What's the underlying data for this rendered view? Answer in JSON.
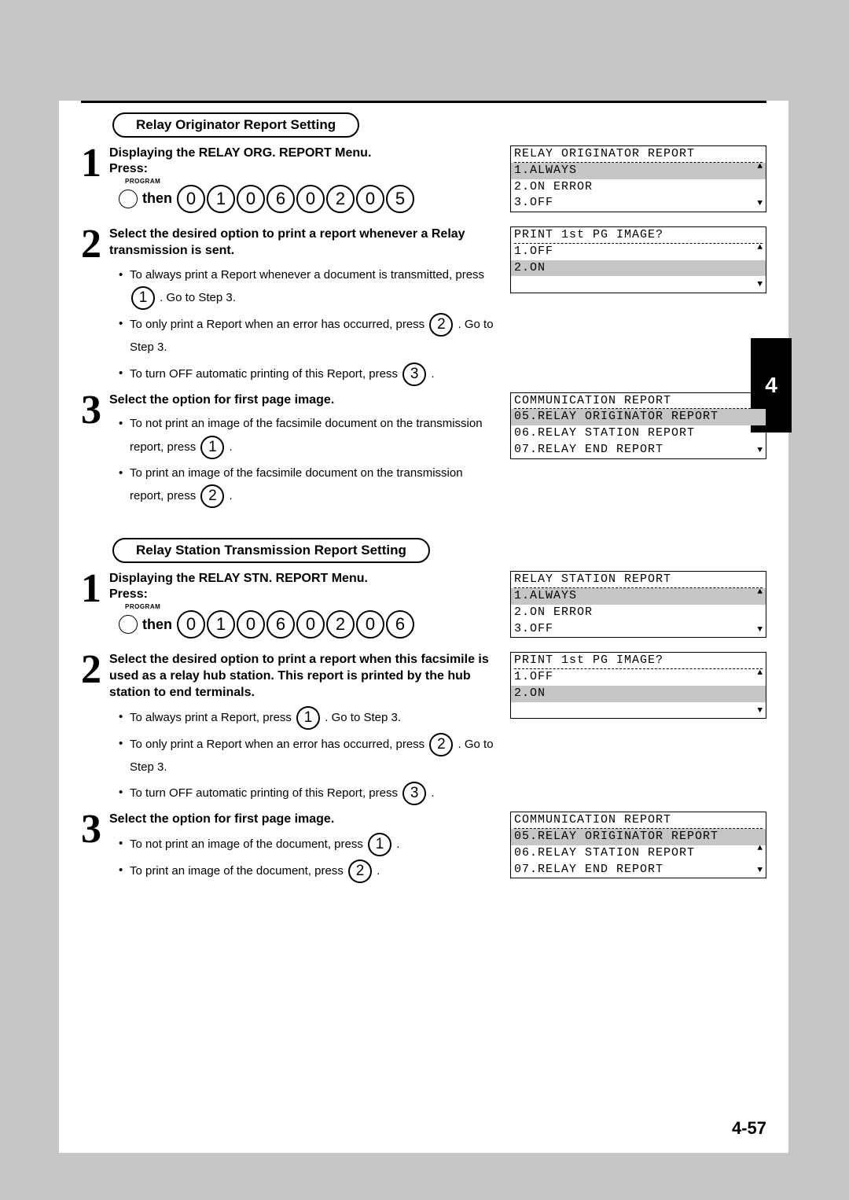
{
  "chapter_tab": "4",
  "page_number": "4-57",
  "sections": {
    "originator": {
      "pill": "Relay Originator Report Setting",
      "step1": {
        "title": "Displaying the RELAY ORG. REPORT Menu.",
        "press": "Press:",
        "program": "PROGRAM",
        "then": "then",
        "keys": [
          "0",
          "1",
          "0",
          "6",
          "0",
          "2",
          "0",
          "5"
        ]
      },
      "step2": {
        "title": "Select the desired option to print a report whenever a Relay transmission is sent.",
        "b1a": "To always print a Report whenever a document is transmitted, press ",
        "b1key": "1",
        "b1b": ".  Go to Step 3.",
        "b2a": "To only print a Report when an error has occurred, press ",
        "b2key": "2",
        "b2b": ".  Go to Step 3.",
        "b3a": "To turn OFF automatic printing of this Report, press ",
        "b3key": "3",
        "b3b": "."
      },
      "step3": {
        "title": "Select the option for first page image.",
        "b1a": "To not print an image of the facsimile document on the transmission report, press ",
        "b1key": "1",
        "b1b": ".",
        "b2a": "To print an image of the facsimile document on the transmission report, press ",
        "b2key": "2",
        "b2b": "."
      },
      "lcd1": {
        "title": "RELAY ORIGINATOR REPORT",
        "r1": "1.ALWAYS",
        "r2": "2.ON ERROR",
        "r3": "3.OFF"
      },
      "lcd2": {
        "title": "PRINT 1st PG IMAGE?",
        "r1": "1.OFF",
        "r2": "2.ON"
      },
      "lcd3": {
        "title": "COMMUNICATION REPORT",
        "r1": "05.RELAY ORIGINATOR REPORT",
        "r2": "06.RELAY STATION REPORT",
        "r3": "07.RELAY END REPORT"
      }
    },
    "station": {
      "pill": "Relay Station Transmission Report Setting",
      "step1": {
        "title": "Displaying the RELAY STN. REPORT Menu.",
        "press": "Press:",
        "program": "PROGRAM",
        "then": "then",
        "keys": [
          "0",
          "1",
          "0",
          "6",
          "0",
          "2",
          "0",
          "6"
        ]
      },
      "step2": {
        "title": "Select the desired option to print a report when this facsimile is used as a relay hub station. This report is printed by the hub station to end terminals.",
        "b1a": "To always print a Report, press ",
        "b1key": "1",
        "b1b": ".  Go to Step 3.",
        "b2a": "To only print a Report when an error has occurred, press ",
        "b2key": "2",
        "b2b": ".  Go to Step 3.",
        "b3a": "To turn OFF automatic printing of this Report, press ",
        "b3key": "3",
        "b3b": "."
      },
      "step3": {
        "title": "Select the option for first page image.",
        "b1a": "To not print an image of the document, press ",
        "b1key": "1",
        "b1b": ".",
        "b2a": "To print an image of the document, press ",
        "b2key": "2",
        "b2b": "."
      },
      "lcd1": {
        "title": "RELAY STATION REPORT",
        "r1": "1.ALWAYS",
        "r2": "2.ON ERROR",
        "r3": "3.OFF"
      },
      "lcd2": {
        "title": "PRINT 1st PG IMAGE?",
        "r1": "1.OFF",
        "r2": "2.ON"
      },
      "lcd3": {
        "title": "COMMUNICATION REPORT",
        "r1": "05.RELAY ORIGINATOR REPORT",
        "r2": "06.RELAY STATION REPORT",
        "r3": "07.RELAY END REPORT"
      }
    }
  }
}
